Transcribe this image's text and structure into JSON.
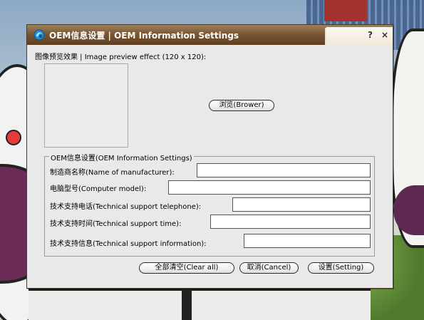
{
  "window": {
    "title": "OEM信息设置 | OEM Information Settings",
    "help_label": "?",
    "close_label": "×"
  },
  "preview": {
    "label": "图像预览效果 | Image preview effect (120 x 120):"
  },
  "browse_button": "浏览(Brower)",
  "group": {
    "title": "OEM信息设置(OEM Information Settings)",
    "fields": [
      {
        "label": "制造商名称(Name of manufacturer):",
        "value": ""
      },
      {
        "label": "电脑型号(Computer model):",
        "value": ""
      },
      {
        "label": "技术支持电话(Technical support telephone):",
        "value": ""
      },
      {
        "label": "技术支持时间(Technical support time):",
        "value": ""
      },
      {
        "label": "技术支持信息(Technical support information):",
        "value": ""
      }
    ]
  },
  "buttons": {
    "clear_all": "全部清空(Clear all)",
    "cancel": "取消(Cancel)",
    "setting": "设置(Setting)"
  },
  "colors": {
    "titlebar": "#7a5733",
    "window_bg": "#e9e9e9"
  }
}
